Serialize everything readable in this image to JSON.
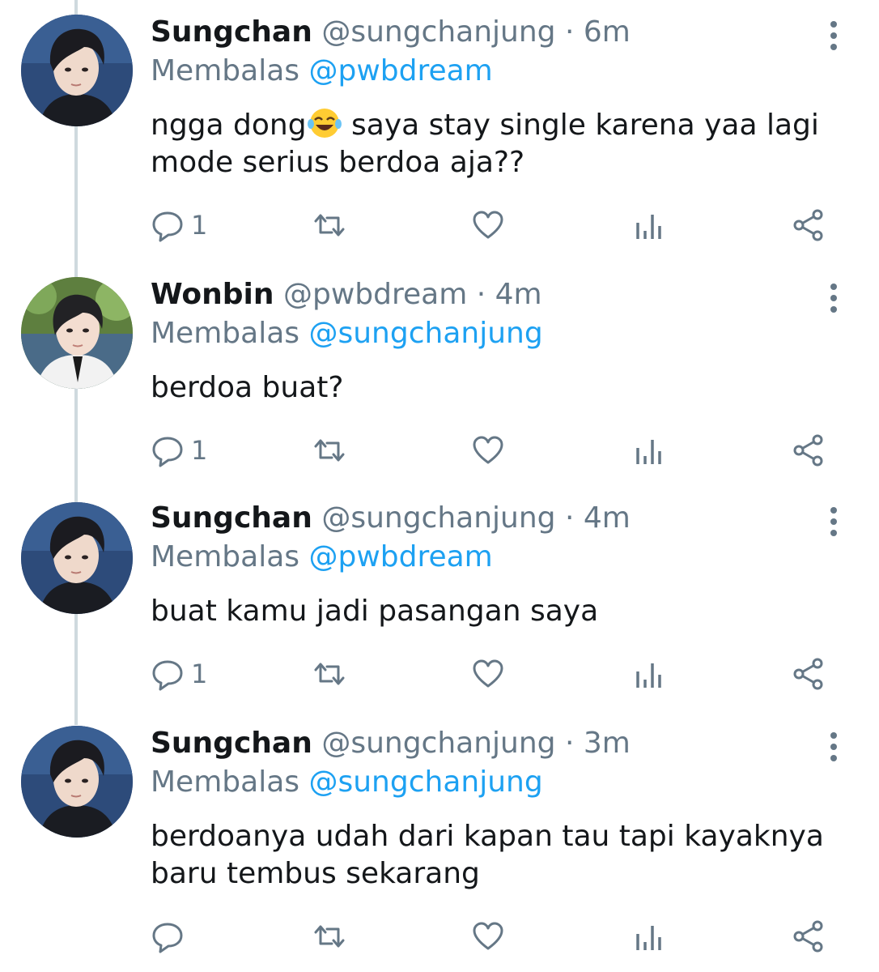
{
  "colors": {
    "text": "#14171a",
    "muted": "#657786",
    "link": "#1da1f2",
    "thread_line": "#cfd9de"
  },
  "replying_prefix": "Membalas",
  "tweets": [
    {
      "name": "Sungchan",
      "handle": "@sungchanjung",
      "dot": "·",
      "time": "6m",
      "reply_to": "@pwbdream",
      "text_before_emoji": "ngga dong",
      "emoji": "face-with-tears-of-joy",
      "text_after_emoji": " saya stay single karena yaa lagi mode serius berdoa aja??",
      "reply_count": "1"
    },
    {
      "name": "Wonbin",
      "handle": "@pwbdream",
      "dot": "·",
      "time": "4m",
      "reply_to": "@sungchanjung",
      "text": "berdoa buat?",
      "reply_count": "1"
    },
    {
      "name": "Sungchan",
      "handle": "@sungchanjung",
      "dot": "·",
      "time": "4m",
      "reply_to": "@pwbdream",
      "text": "buat kamu jadi pasangan saya",
      "reply_count": "1"
    },
    {
      "name": "Sungchan",
      "handle": "@sungchanjung",
      "dot": "·",
      "time": "3m",
      "reply_to": "@sungchanjung",
      "text": "berdoanya udah dari kapan tau tapi kayaknya baru tembus sekarang",
      "reply_count": ""
    }
  ]
}
